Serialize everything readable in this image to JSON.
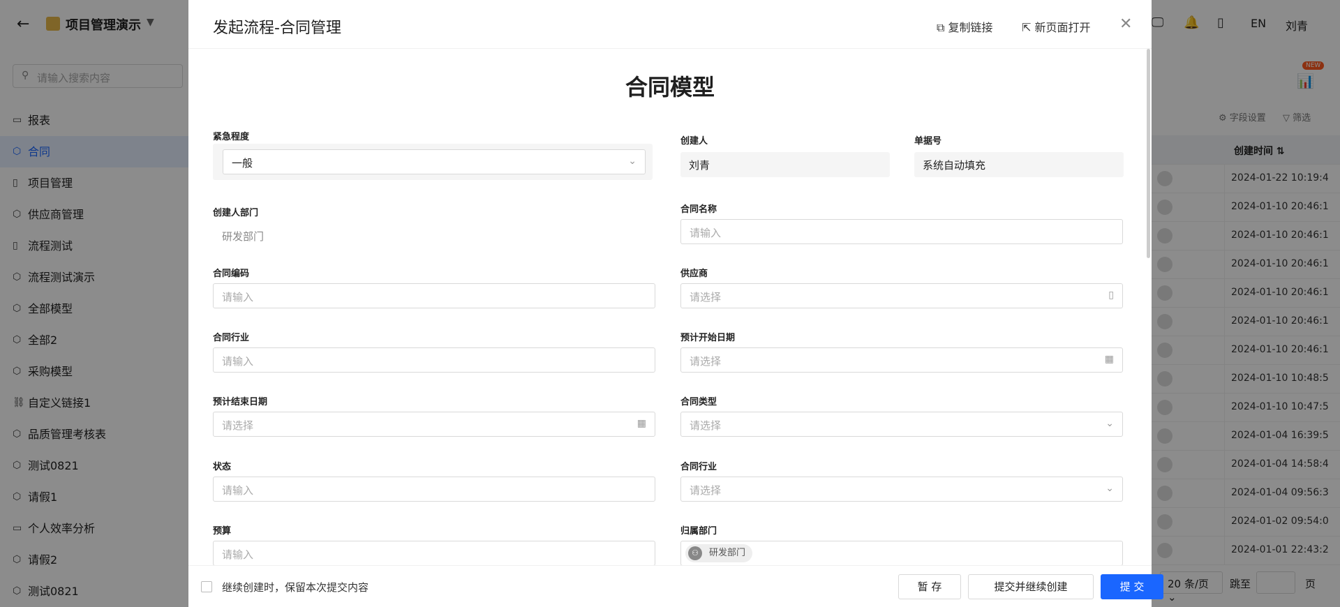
{
  "app": {
    "title": "项目管理演示",
    "lang": "EN",
    "user": "刘青"
  },
  "sidebar": {
    "search_placeholder": "请输入搜索内容",
    "items": [
      {
        "label": "报表",
        "icon": "report-icon",
        "active": false
      },
      {
        "label": "合同",
        "icon": "cube-icon",
        "active": true
      },
      {
        "label": "项目管理",
        "icon": "document-icon",
        "active": false
      },
      {
        "label": "供应商管理",
        "icon": "cube-icon",
        "active": false
      },
      {
        "label": "流程测试",
        "icon": "document-icon",
        "active": false
      },
      {
        "label": "流程测试演示",
        "icon": "cube-icon",
        "active": false
      },
      {
        "label": "全部模型",
        "icon": "cube-icon",
        "active": false
      },
      {
        "label": "全部2",
        "icon": "cube-icon",
        "active": false
      },
      {
        "label": "采购模型",
        "icon": "cube-icon",
        "active": false
      },
      {
        "label": "自定义链接1",
        "icon": "link-icon",
        "active": false
      },
      {
        "label": "品质管理考核表",
        "icon": "cube-icon",
        "active": false
      },
      {
        "label": "测试0821",
        "icon": "cube-icon",
        "active": false
      },
      {
        "label": "请假1",
        "icon": "cube-icon",
        "active": false
      },
      {
        "label": "个人效率分析",
        "icon": "report-icon",
        "active": false
      },
      {
        "label": "请假2",
        "icon": "cube-icon",
        "active": false
      },
      {
        "label": "测试0821",
        "icon": "cube-icon",
        "active": false
      }
    ]
  },
  "list": {
    "new_badge": "NEW",
    "field_settings": "字段设置",
    "filter": "筛选",
    "column_title": "创建时间",
    "rows": [
      "2024-01-22 10:19:4",
      "2024-01-10 20:46:1",
      "2024-01-10 20:46:1",
      "2024-01-10 20:46:1",
      "2024-01-10 20:46:1",
      "2024-01-10 20:46:1",
      "2024-01-10 20:46:1",
      "2024-01-10 10:48:5",
      "2024-01-10 10:47:5",
      "2024-01-04 16:39:5",
      "2024-01-04 14:58:4",
      "2024-01-04 09:56:3",
      "2024-01-02 09:54:0",
      "2024-01-01 22:43:2"
    ],
    "page_size": "20 条/页",
    "jump_label": "跳至",
    "page_label": "页"
  },
  "drawer": {
    "title": "发起流程-合同管理",
    "copy_link": "复制链接",
    "open_new_page": "新页面打开",
    "form_title": "合同模型",
    "fields": {
      "urgency": {
        "label": "紧急程度",
        "value": "一般"
      },
      "creator": {
        "label": "创建人",
        "value": "刘青"
      },
      "doc_no": {
        "label": "单据号",
        "value": "系统自动填充"
      },
      "creator_dept": {
        "label": "创建人部门",
        "value": "研发部门"
      },
      "contract_name": {
        "label": "合同名称",
        "placeholder": "请输入"
      },
      "contract_code": {
        "label": "合同编码",
        "placeholder": "请输入"
      },
      "supplier": {
        "label": "供应商",
        "placeholder": "请选择"
      },
      "contract_industry": {
        "label": "合同行业",
        "placeholder": "请输入"
      },
      "start_date": {
        "label": "预计开始日期",
        "placeholder": "请选择"
      },
      "end_date": {
        "label": "预计结束日期",
        "placeholder": "请选择"
      },
      "contract_type": {
        "label": "合同类型",
        "placeholder": "请选择"
      },
      "status": {
        "label": "状态",
        "placeholder": "请输入"
      },
      "contract_industry2": {
        "label": "合同行业",
        "placeholder": "请选择"
      },
      "budget": {
        "label": "预算",
        "placeholder": "请输入"
      },
      "owner_dept": {
        "label": "归属部门",
        "tag": "研发部门"
      }
    },
    "footer": {
      "keep_label": "继续创建时，保留本次提交内容",
      "save": "暂 存",
      "submit_continue": "提交并继续创建",
      "submit": "提 交"
    }
  }
}
